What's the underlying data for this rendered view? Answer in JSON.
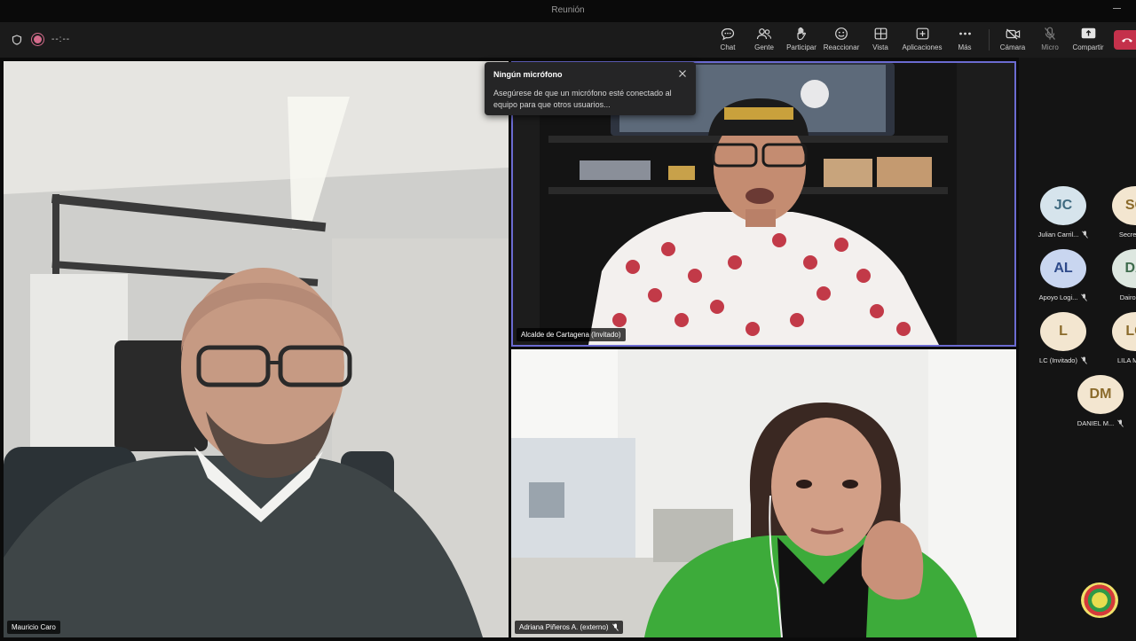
{
  "window": {
    "title": "Reunión"
  },
  "toolbar": {
    "timer": "--:--",
    "actions": [
      {
        "label": "Chat",
        "icon": "chat-icon"
      },
      {
        "label": "Gente",
        "icon": "people-icon"
      },
      {
        "label": "Participar",
        "icon": "raise-hand-icon"
      },
      {
        "label": "Reaccionar",
        "icon": "react-icon"
      },
      {
        "label": "Vista",
        "icon": "view-icon"
      },
      {
        "label": "Aplicaciones",
        "icon": "apps-icon"
      },
      {
        "label": "Más",
        "icon": "more-icon"
      }
    ],
    "media": [
      {
        "label": "Cámara",
        "icon": "camera-off-icon"
      },
      {
        "label": "Micro",
        "icon": "mic-off-icon"
      },
      {
        "label": "Compartir",
        "icon": "share-icon"
      }
    ],
    "hangup_icon": "hangup-icon"
  },
  "notification": {
    "title": "Ningún micrófono",
    "body": "Asegúrese de que un micrófono esté conectado al equipo para que otros usuarios..."
  },
  "tiles": [
    {
      "name": "Mauricio Caro"
    },
    {
      "name": "Alcalde de Cartagena (Invitado)"
    },
    {
      "name": "Adriana Piñeros A. (externo)"
    }
  ],
  "roster": [
    {
      "initials": "JC",
      "name": "Julian Carril...",
      "avatar_bg": "#d6e4ec",
      "avatar_fg": "#3f6a80"
    },
    {
      "initials": "SC",
      "name": "Secretari...",
      "avatar_bg": "#f3e6d0",
      "avatar_fg": "#8a6a2a"
    },
    {
      "initials": "AL",
      "name": "Apoyo Logi...",
      "avatar_bg": "#c9d6f0",
      "avatar_fg": "#2e4a8a"
    },
    {
      "initials": "DA",
      "name": "Dairo Alf...",
      "avatar_bg": "#dde7e0",
      "avatar_fg": "#3e6b4c"
    },
    {
      "initials": "L",
      "name": "LC (Invitado)",
      "avatar_bg": "#f3e6d0",
      "avatar_fg": "#8a6a2a"
    },
    {
      "initials": "LC",
      "name": "LILA MAR...",
      "avatar_bg": "#f3e6d0",
      "avatar_fg": "#8a6a2a"
    },
    {
      "initials": "DM",
      "name": "DANIEL M...",
      "avatar_bg": "#f3e6d0",
      "avatar_fg": "#8a6a2a"
    }
  ],
  "colors": {
    "accent_border": "#6b6bd1",
    "hangup": "#c4314b",
    "toolbar_bg": "#1b1b1b"
  }
}
